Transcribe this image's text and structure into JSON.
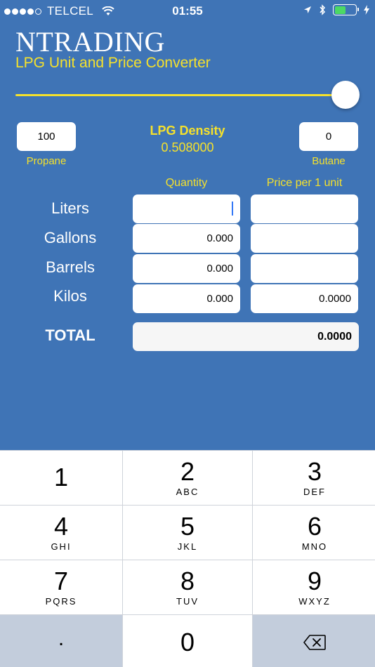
{
  "status_bar": {
    "carrier": "TELCEL",
    "time": "01:55"
  },
  "header": {
    "brand": "NTRADING",
    "subtitle": "LPG Unit and Price Converter"
  },
  "slider": {
    "value_fraction": 1.0
  },
  "mix": {
    "propane_value": "100",
    "propane_label": "Propane",
    "butane_value": "0",
    "butane_label": "Butane",
    "density_title": "LPG Density",
    "density_value": "0.508000"
  },
  "columns": {
    "quantity": "Quantity",
    "price": "Price per 1 unit"
  },
  "rows": [
    {
      "label": "Liters",
      "quantity": "",
      "price": ""
    },
    {
      "label": "Gallons",
      "quantity": "0.000",
      "price": ""
    },
    {
      "label": "Barrels",
      "quantity": "0.000",
      "price": ""
    },
    {
      "label": "Kilos",
      "quantity": "0.000",
      "price": "0.0000"
    }
  ],
  "total": {
    "label": "TOTAL",
    "value": "0.0000"
  },
  "keypad": {
    "keys": [
      {
        "num": "1",
        "letters": ""
      },
      {
        "num": "2",
        "letters": "ABC"
      },
      {
        "num": "3",
        "letters": "DEF"
      },
      {
        "num": "4",
        "letters": "GHI"
      },
      {
        "num": "5",
        "letters": "JKL"
      },
      {
        "num": "6",
        "letters": "MNO"
      },
      {
        "num": "7",
        "letters": "PQRS"
      },
      {
        "num": "8",
        "letters": "TUV"
      },
      {
        "num": "9",
        "letters": "WXYZ"
      },
      {
        "num": ".",
        "letters": ""
      },
      {
        "num": "0",
        "letters": ""
      }
    ]
  },
  "colors": {
    "background": "#3f74b6",
    "accent_yellow": "#f5e12c",
    "battery_green": "#4cd964"
  }
}
